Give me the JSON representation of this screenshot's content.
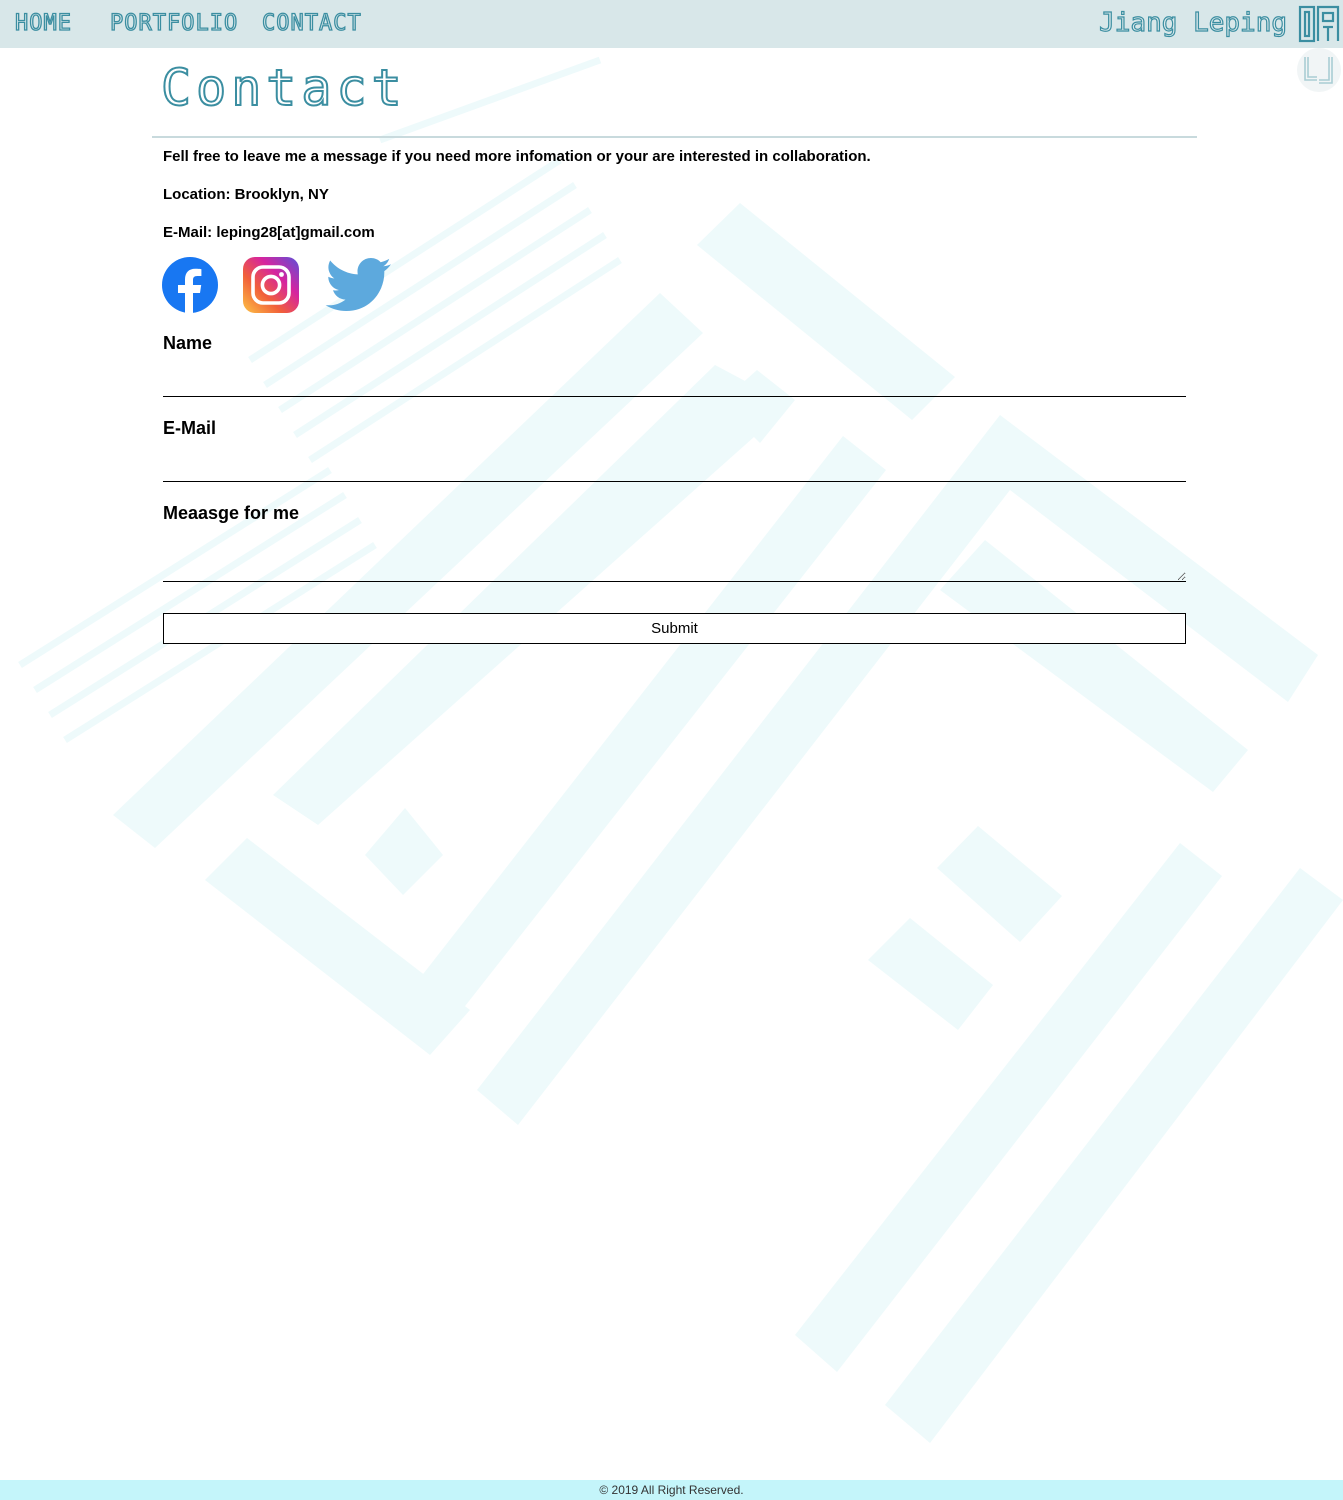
{
  "nav": {
    "home": "HOME",
    "portfolio": "PORTFOLIO",
    "contact": "CONTACT",
    "brand": "Jiang Leping"
  },
  "page": {
    "title": "Contact",
    "intro": "Fell free to leave me a message if you need more infomation or your are interested in collaboration.",
    "location": "Location: Brooklyn, NY",
    "email": "E-Mail: leping28[at]gmail.com"
  },
  "social": [
    {
      "icon": "facebook-icon",
      "color": "#1877f2"
    },
    {
      "icon": "instagram-icon",
      "color": "#d6249f"
    },
    {
      "icon": "twitter-icon",
      "color": "#5da9dd"
    }
  ],
  "form": {
    "name_label": "Name",
    "name_value": "",
    "email_label": "E-Mail",
    "email_value": "",
    "message_label": "Meaasge for me",
    "message_value": "",
    "submit_label": "Submit"
  },
  "footer": {
    "copyright": "© 2019 All Right Reserved."
  },
  "colors": {
    "accent": "#3b8ea1",
    "nav_bg": "#d8e7e9",
    "footer_bg": "#c4f5fa",
    "watermark": "#eef9fa"
  }
}
